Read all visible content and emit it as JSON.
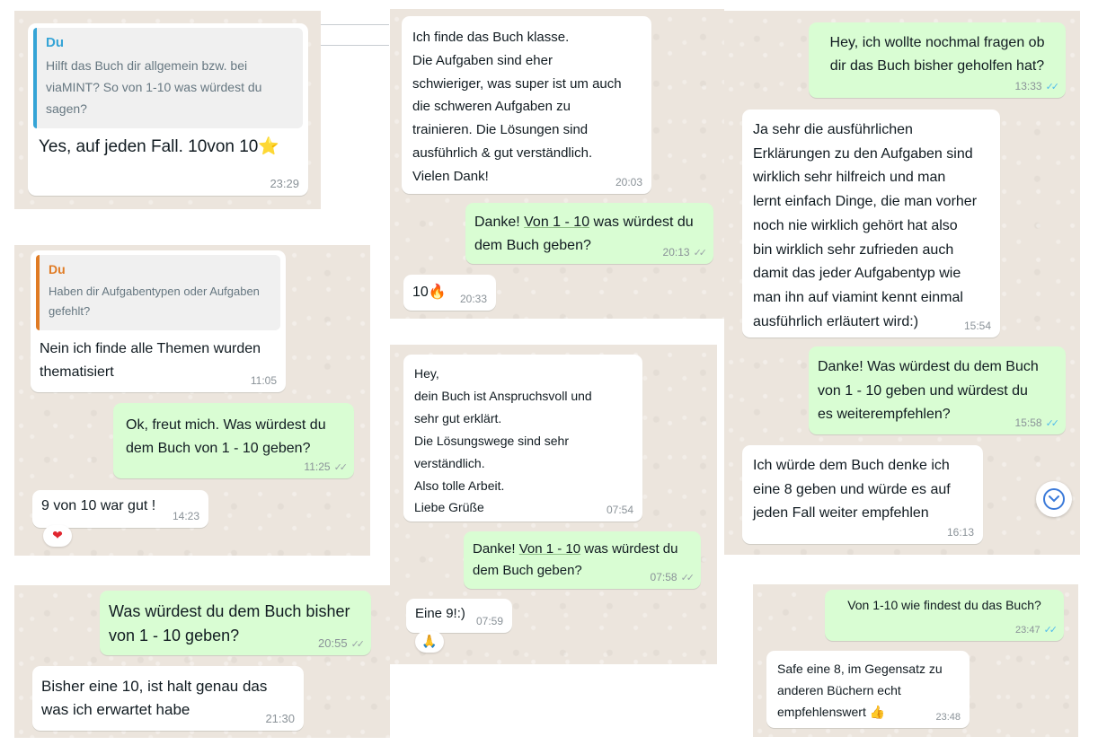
{
  "chat1": {
    "quote": {
      "author": "Du",
      "text": "Hilft das Buch dir allgemein bzw. bei\nviaMINT? So von 1-10 was würdest du\nsagen?"
    },
    "reply": {
      "text": "Yes, auf jeden Fall. 10von 10",
      "emoji": "⭐",
      "time": "23:29"
    }
  },
  "chat2": {
    "quote": {
      "author": "Du",
      "text": "Haben dir Aufgabentypen oder Aufgaben\ngefehlt?"
    },
    "reply": {
      "text": "Nein ich finde alle Themen wurden\nthematisiert",
      "time": "11:05"
    },
    "outgoing": {
      "text": "Ok, freut mich. Was würdest du\ndem Buch von 1 - 10 geben?",
      "time": "11:25"
    },
    "answer": {
      "text": "9 von 10 war gut !",
      "time": "14:23"
    },
    "reaction": "❤"
  },
  "chat3": {
    "outgoing": {
      "text": "Was würdest du dem Buch bisher\nvon 1 - 10 geben?",
      "time": "20:55"
    },
    "reply": {
      "text": "Bisher eine 10, ist halt genau das\nwas ich erwartet habe",
      "time": "21:30"
    }
  },
  "chat4": {
    "incoming": {
      "text": "Ich finde das Buch klasse.\nDie Aufgaben sind eher\nschwieriger, was super ist um auch\ndie schweren Aufgaben zu\ntrainieren. Die Lösungen sind\nausführlich &  gut verständlich.\nVielen Dank!",
      "time": "20:03"
    },
    "outgoing": {
      "prefix": "Danke! ",
      "underlined": "Von 1 - 10",
      "suffix": " was würdest du\ndem Buch geben?",
      "time": "20:13"
    },
    "reply": {
      "text": "10",
      "emoji": "🔥",
      "time": "20:33"
    }
  },
  "chat5": {
    "incoming": {
      "text": "Hey,\ndein Buch ist Anspruchsvoll und\nsehr gut erklärt.\nDie Lösungswege sind sehr\nverständlich.\nAlso tolle Arbeit.\nLiebe Grüße",
      "time": "07:54"
    },
    "outgoing": {
      "prefix": "Danke! ",
      "underlined": "Von 1 - 10",
      "suffix": " was würdest du\ndem Buch geben?",
      "time": "07:58"
    },
    "reply": {
      "text": "Eine 9!:)",
      "time": "07:59"
    },
    "reaction": "🙏"
  },
  "chat6": {
    "outgoing1": {
      "text": "Hey, ich wollte nochmal fragen ob\ndir das Buch bisher geholfen hat?",
      "time": "13:33"
    },
    "incoming1": {
      "text": "Ja sehr die ausführlichen\nErklärungen zu den Aufgaben sind\nwirklich sehr hilfreich und man\nlernt einfach Dinge, die man vorher\nnoch nie wirklich gehört hat also\nbin wirklich sehr zufrieden auch\ndamit das jeder Aufgabentyp wie\nman ihn auf viamint kennt einmal\nausführlich erläutert wird:)",
      "time": "15:54"
    },
    "outgoing2": {
      "text": "Danke! Was würdest du dem Buch\nvon 1 - 10 geben und würdest du\nes weiterempfehlen?",
      "time": "15:58"
    },
    "incoming2": {
      "text": "Ich würde dem Buch denke ich\neine 8 geben und würde es auf\njeden Fall weiter empfehlen",
      "time": "16:13"
    }
  },
  "chat7": {
    "outgoing": {
      "text": "Von 1-10 wie findest du das Buch?",
      "time": "23:47"
    },
    "reply": {
      "text": "Safe eine 8, im Gegensatz zu\nanderen Büchern echt\nempfehlenswert",
      "emoji": "👍",
      "time": "23:48"
    }
  },
  "icons": {
    "ticks": "✓✓"
  }
}
